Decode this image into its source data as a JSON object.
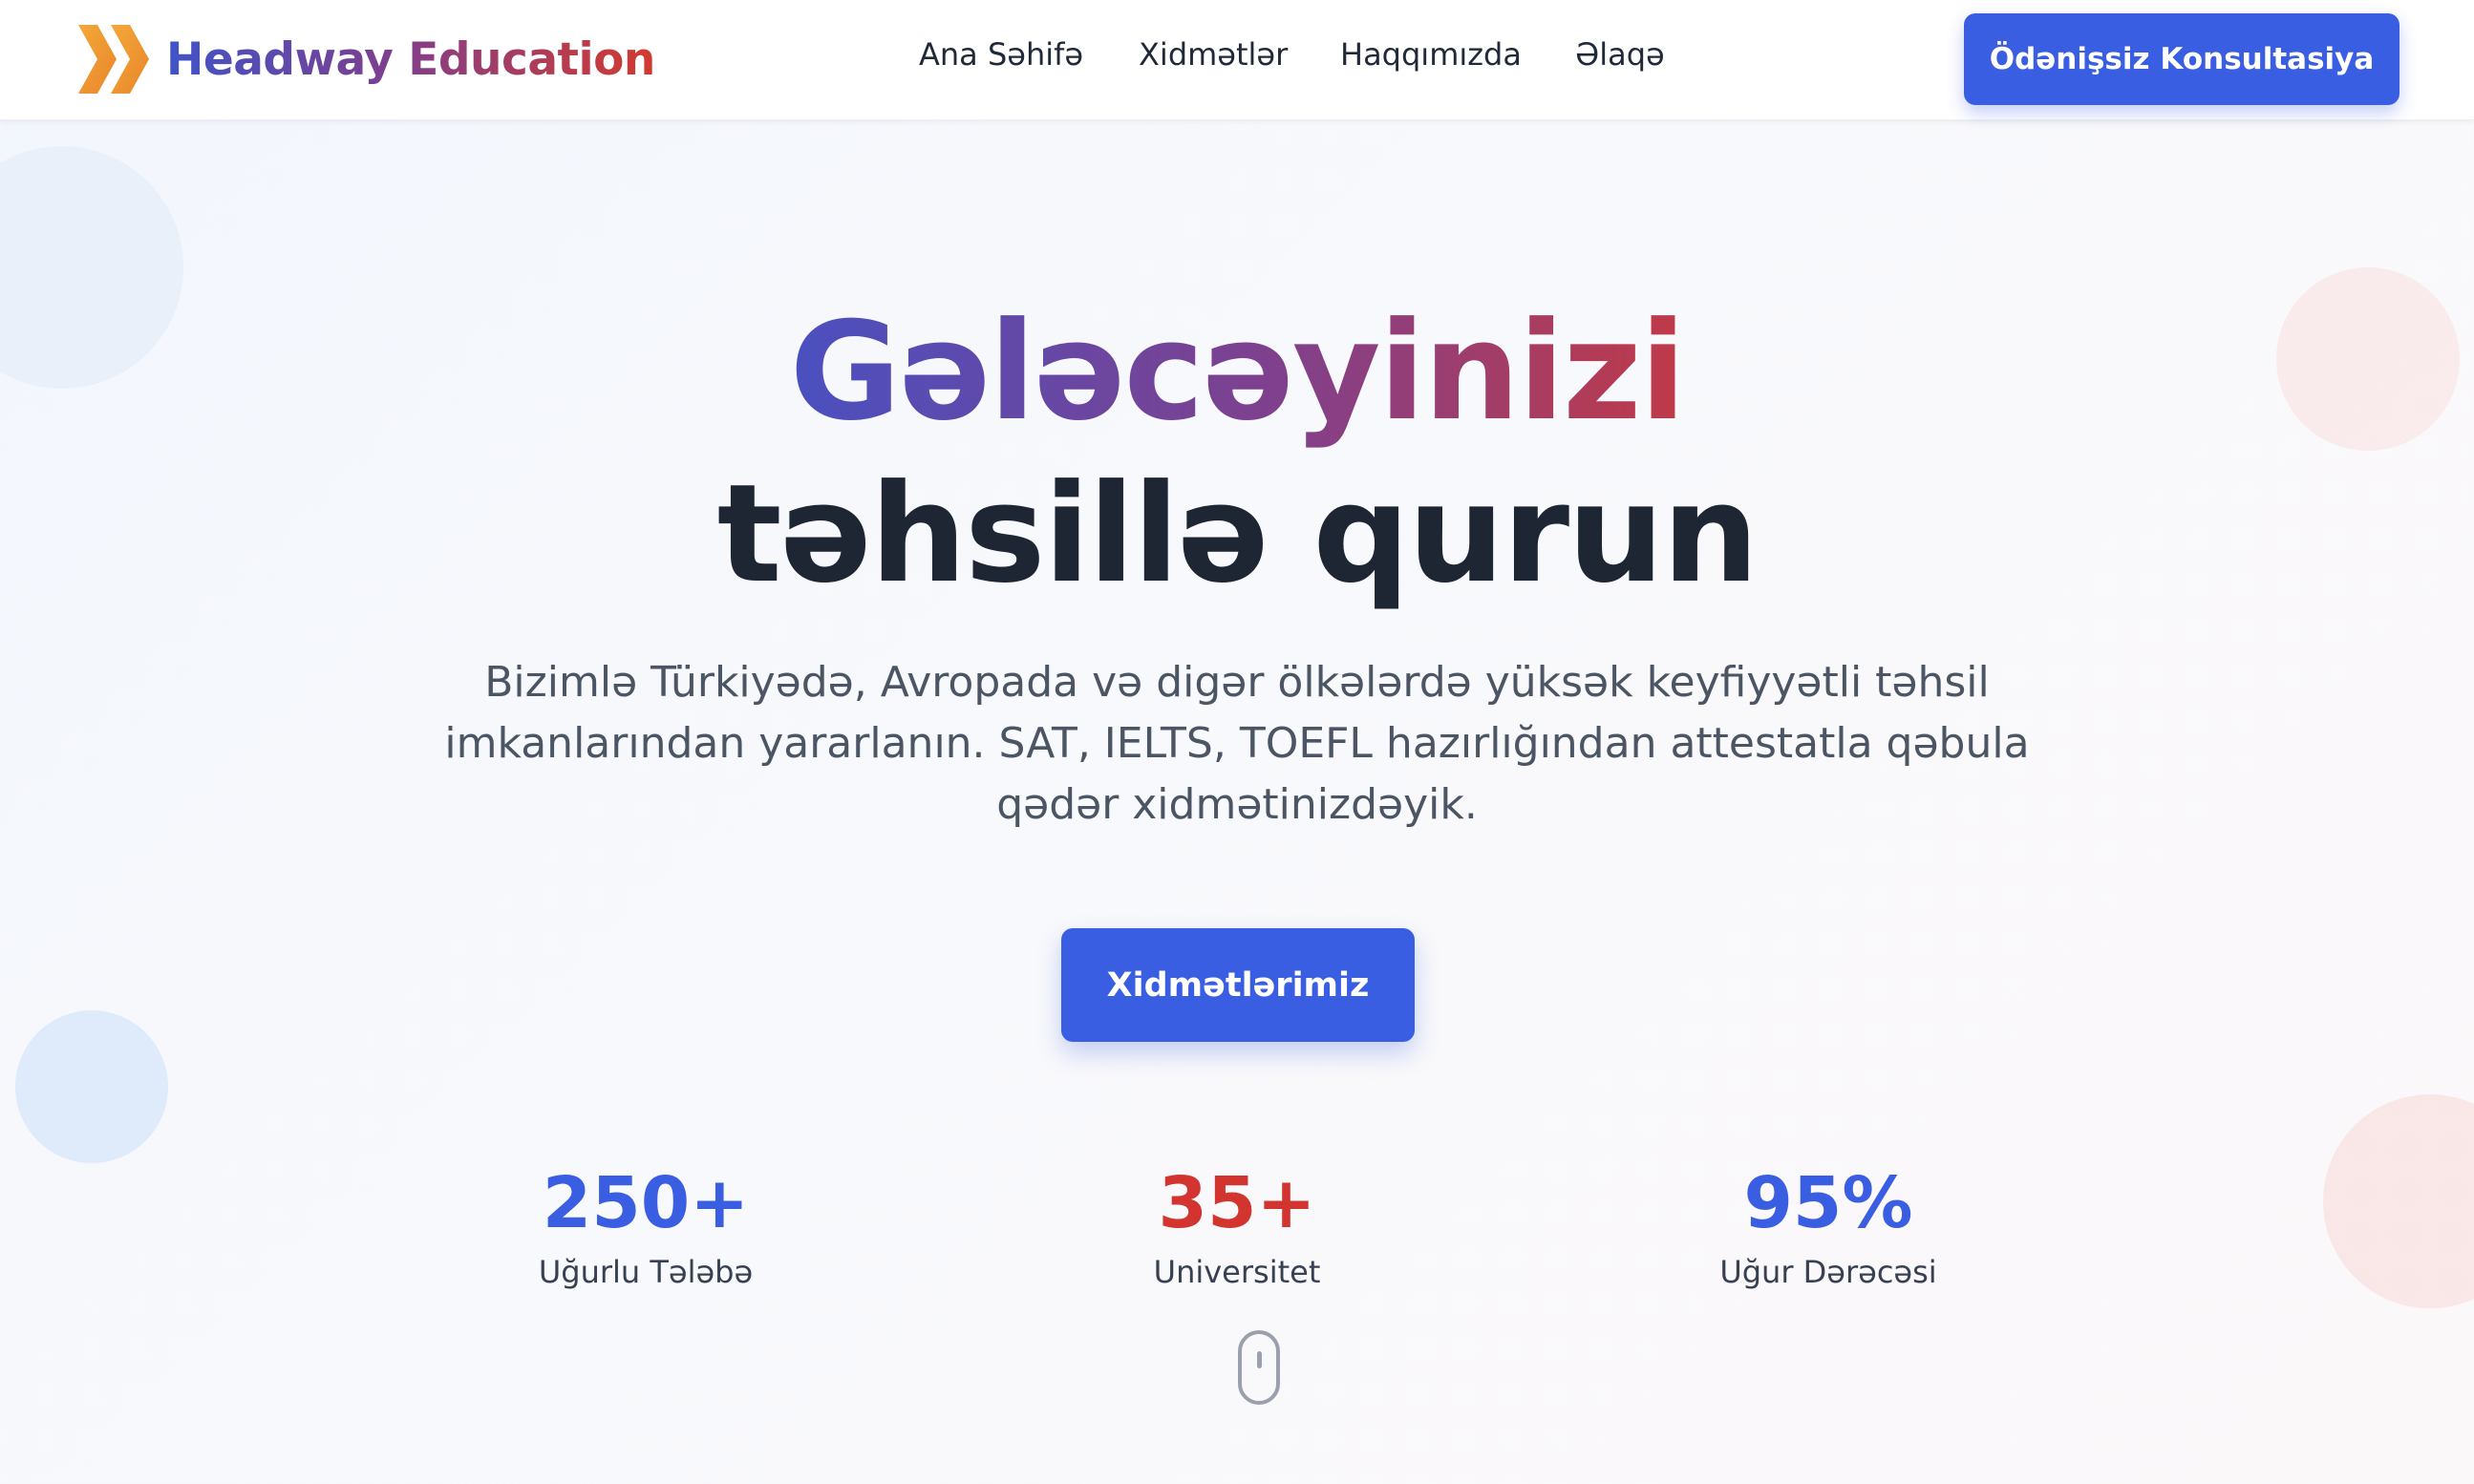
{
  "header": {
    "logo_text": "Headway Education",
    "nav": [
      {
        "label": "Ana Səhifə"
      },
      {
        "label": "Xidmətlər"
      },
      {
        "label": "Haqqımızda"
      },
      {
        "label": "Əlaqə"
      }
    ],
    "cta_label": "Ödənişsiz Konsultasiya"
  },
  "hero": {
    "title_line1": "Gələcəyinizi",
    "title_line2": "təhsillə qurun",
    "subtitle": "Bizimlə Türkiyədə, Avropada və digər ölkələrdə yüksək keyfiyyətli təhsil imkanlarından yararlanın. SAT, IELTS, TOEFL hazırlığından attestatla qəbula qədər xidmətinizdəyik.",
    "cta_label": "Xidmətlərimiz"
  },
  "stats": [
    {
      "value": "250+",
      "label": "Uğurlu Tələbə",
      "color": "#3a5ee2"
    },
    {
      "value": "35+",
      "label": "Universitet",
      "color": "#d2352f"
    },
    {
      "value": "95%",
      "label": "Uğur Dərəcəsi",
      "color": "#3a5ee2"
    }
  ],
  "icons": {
    "logo": "double-chevron-icon",
    "scroll": "mouse-scroll-icon"
  },
  "colors": {
    "primary": "#3a5ee2",
    "accent_red": "#d2352f",
    "logo_orange": "#f0a030",
    "heading_dark": "#1e2533"
  }
}
